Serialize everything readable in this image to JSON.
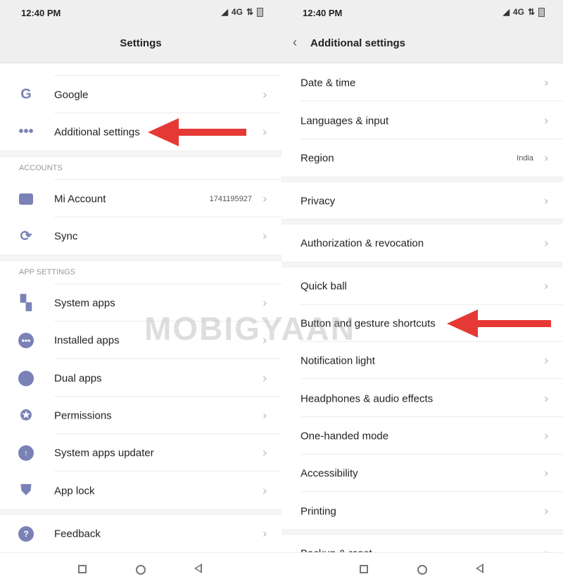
{
  "left": {
    "time": "12:40 PM",
    "network": "4G",
    "title": "Settings",
    "items": [
      {
        "label": "Google",
        "icon": "google-icon"
      },
      {
        "label": "Additional settings",
        "icon": "more-dots-icon"
      },
      {
        "label": "Mi Account",
        "value": "1741195927",
        "icon": "mi-account-icon"
      },
      {
        "label": "Sync",
        "icon": "sync-icon"
      },
      {
        "label": "System apps",
        "icon": "system-apps-icon"
      },
      {
        "label": "Installed apps",
        "icon": "installed-apps-icon"
      },
      {
        "label": "Dual apps",
        "icon": "dual-apps-icon"
      },
      {
        "label": "Permissions",
        "icon": "permissions-icon"
      },
      {
        "label": "System apps updater",
        "icon": "updater-icon"
      },
      {
        "label": "App lock",
        "icon": "app-lock-icon"
      },
      {
        "label": "Feedback",
        "icon": "feedback-icon"
      }
    ],
    "sections": {
      "accounts": "ACCOUNTS",
      "app_settings": "APP SETTINGS"
    }
  },
  "right": {
    "time": "12:40 PM",
    "network": "4G",
    "title": "Additional settings",
    "items": [
      {
        "label": "Date & time"
      },
      {
        "label": "Languages & input"
      },
      {
        "label": "Region",
        "value": "India"
      },
      {
        "label": "Privacy"
      },
      {
        "label": "Authorization & revocation"
      },
      {
        "label": "Quick ball"
      },
      {
        "label": "Button and gesture shortcuts"
      },
      {
        "label": "Notification light"
      },
      {
        "label": "Headphones & audio effects"
      },
      {
        "label": "One-handed mode"
      },
      {
        "label": "Accessibility"
      },
      {
        "label": "Printing"
      },
      {
        "label": "Backup & reset"
      }
    ]
  },
  "watermark": "MOBIGYAAN",
  "colors": {
    "icon": "#7a81b6",
    "arrow": "#e53935",
    "header": "#efefef"
  }
}
